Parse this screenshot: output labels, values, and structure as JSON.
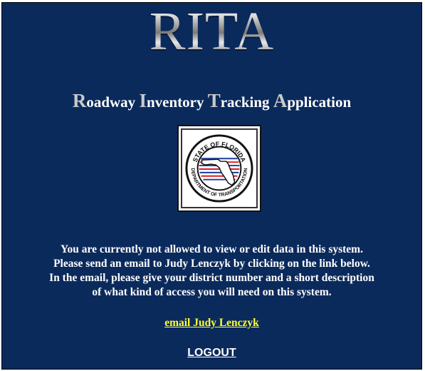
{
  "header": {
    "logo_text": "RITA",
    "app_name_parts": [
      {
        "cap": "R",
        "rest": "oadway "
      },
      {
        "cap": "I",
        "rest": "nventory "
      },
      {
        "cap": "T",
        "rest": "racking "
      },
      {
        "cap": "A",
        "rest": "pplication"
      }
    ]
  },
  "seal": {
    "top_text": "STATE OF FLORIDA",
    "bottom_text": "DEPARTMENT OF TRANSPORTATION",
    "icon": "fdot-seal-icon"
  },
  "message": {
    "lines": [
      "You are currently not allowed to view or edit data in this system.",
      "Please send an email to Judy Lenczyk by clicking on the link below.",
      "In the email, please give your district number and a short description",
      "of what kind of access you will need on this system."
    ]
  },
  "links": {
    "email_label": "email Judy Lenczyk",
    "logout_label": "LOGOUT"
  },
  "colors": {
    "background": "#0b2a5c",
    "link": "#ffff33",
    "text": "#ffffff"
  }
}
